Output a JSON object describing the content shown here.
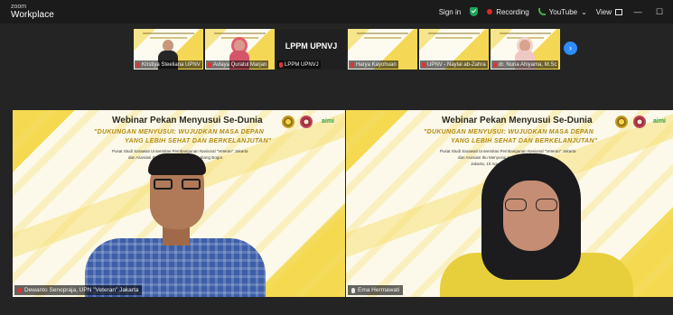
{
  "app": {
    "brand_small": "zoom",
    "brand_main": "Workplace"
  },
  "titlebar": {
    "sign_in": "Sign in",
    "recording": "Recording",
    "youtube": "YouTube",
    "youtube_caret": "⌄",
    "view": "View",
    "minimize": "—",
    "maximize": "☐"
  },
  "filmstrip": {
    "tiles": [
      {
        "name": "Kristiya Steeliana UPNV",
        "style": "dark-man"
      },
      {
        "name": "Avlaya Quratul Marjan",
        "style": "hijab-pink"
      },
      {
        "name": "LPPM UPNVJ",
        "style": "name-only",
        "big_label": "LPPM UPNVJ"
      },
      {
        "name": "Harya Kayohuan",
        "style": "plain"
      },
      {
        "name": "UPNV - Naylai ab-Zahra",
        "style": "plain"
      },
      {
        "name": "dr. Nuria Ahiyama, M.Sc",
        "style": "hijab-light"
      }
    ],
    "next_button": "›"
  },
  "videos": [
    {
      "slide_title": "Webinar Pekan Menyusui Se-Dunia",
      "slide_sub": "\"DUKUNGAN MENYUSUI: WUJUDKAN MASA DEPAN",
      "slide_sub2": "YANG LEBIH SEHAT DAN BERKELANJUTAN\"",
      "org_line1": "Pusat Studi Sarawati Universitas Pembangunan Nasional \"Veteran\" Jakarta",
      "org_line2": "dan Asosiasi Ibu Menyusui Indonesia Cabang Bogor",
      "logo_text": "aimi",
      "participant": "Dewanto Senopraja, UPN \"Veteran\" Jakarta"
    },
    {
      "slide_title": "Webinar Pekan Menyusui Se-Dunia",
      "slide_sub": "\"DUKUNGAN MENYUSUI: WUJUDKAN MASA DEPAN",
      "slide_sub2": "YANG LEBIH SEHAT DAN BERKELANJUTAN\"",
      "org_line1": "Pusat Studi Sarawati Universitas Pembangunan Nasional \"Veteran\" Jakarta",
      "org_line2": "dan Asosiasi Ibu Menyusui Indonesia Cabang Bogor",
      "org_line3": "Jakarta, 10 Agustus 2024",
      "logo_text": "aimi",
      "participant": "Ema Hermawati"
    }
  ]
}
